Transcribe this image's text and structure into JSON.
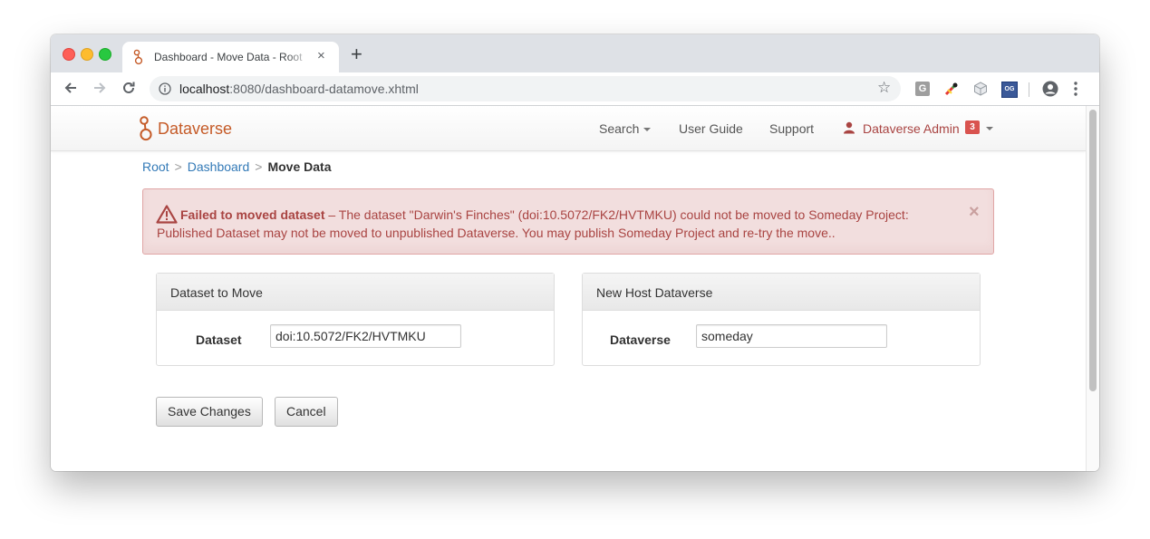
{
  "browser": {
    "tab_title": "Dashboard - Move Data - Root",
    "tab_close": "×",
    "new_tab": "+",
    "url_host": "localhost",
    "url_rest": ":8080/dashboard-datamove.xhtml",
    "ext_g_label": "G",
    "ext_og_label": "OG",
    "star": "☆"
  },
  "navbar": {
    "brand": "Dataverse",
    "search": "Search",
    "user_guide": "User Guide",
    "support": "Support",
    "user": "Dataverse Admin",
    "notifications": "3",
    "colors": {
      "brand": "#c55b28",
      "user": "#a94442",
      "badge": "#d9534f"
    }
  },
  "breadcrumb": {
    "root": "Root",
    "dashboard": "Dashboard",
    "current": "Move Data",
    "separator": ">"
  },
  "alert": {
    "title": "Failed to moved dataset",
    "message": " – The dataset \"Darwin's Finches\" (doi:10.5072/FK2/HVTMKU) could not be moved to Someday Project: Published Dataset may not be moved to unpublished Dataverse. You may publish Someday Project and re-try the move..",
    "close": "×",
    "icon": "warning-triangle-icon"
  },
  "dataset_panel": {
    "heading": "Dataset to Move",
    "label": "Dataset",
    "value": "doi:10.5072/FK2/HVTMKU"
  },
  "host_panel": {
    "heading": "New Host Dataverse",
    "label": "Dataverse",
    "value": "someday"
  },
  "actions": {
    "save": "Save Changes",
    "cancel": "Cancel"
  }
}
